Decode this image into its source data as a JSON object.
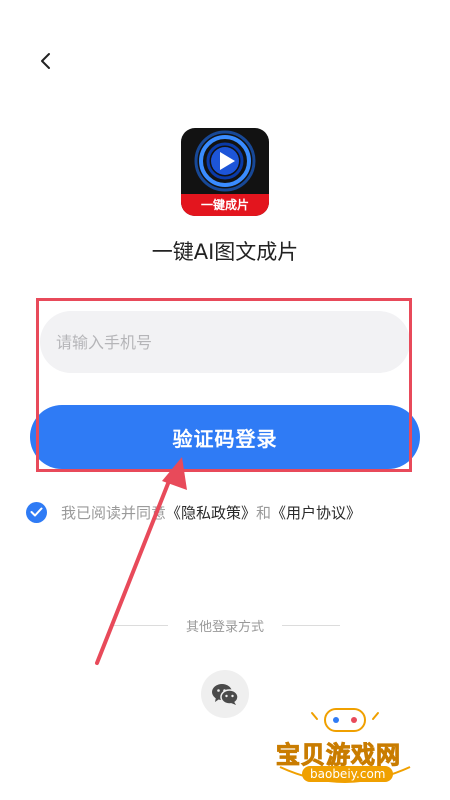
{
  "app": {
    "name": "一键AI图文成片",
    "icon_banner": "一键成片"
  },
  "login_form": {
    "phone_placeholder": "请输入手机号",
    "phone_value": "",
    "login_button_label": "验证码登录"
  },
  "agreement": {
    "checked": true,
    "prefix": "我已阅读并同意",
    "privacy_link": "《隐私政策》",
    "connector": "和",
    "user_agreement_link": "《用户协议》"
  },
  "other_login": {
    "label": "其他登录方式",
    "methods": [
      "wechat-icon"
    ]
  },
  "watermark": {
    "text": "宝贝游戏网",
    "url": "baobeiy.com"
  },
  "colors": {
    "primary": "#2f7bf5",
    "annotation": "#e84a5a",
    "input_bg": "#f2f2f4"
  }
}
